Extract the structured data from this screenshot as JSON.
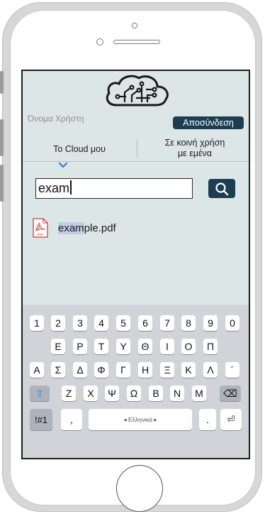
{
  "app": {
    "username_label": "Όνομα Χρήστη",
    "logout_label": "Αποσύνδεση"
  },
  "tabs": {
    "my_cloud": "Το Cloud μου",
    "shared_line1": "Σε κοινή χρήση",
    "shared_line2": "με εμένα"
  },
  "search": {
    "value": "exam",
    "button_icon": "magnifier-icon"
  },
  "results": [
    {
      "match": "exam",
      "rest": "ple.pdf",
      "icon": "pdf-file-icon",
      "icon_text": "PDF"
    }
  ],
  "keyboard": {
    "row1": [
      "1",
      "2",
      "3",
      "4",
      "5",
      "6",
      "7",
      "8",
      "9",
      "0"
    ],
    "row2": [
      "Ε",
      "Ρ",
      "Τ",
      "Υ",
      "Θ",
      "Ι",
      "Ο",
      "Π"
    ],
    "row3": [
      "Α",
      "Σ",
      "Δ",
      "Φ",
      "Γ",
      "Η",
      "Ξ",
      "Κ",
      "Λ",
      "´"
    ],
    "row4": [
      "Ζ",
      "Χ",
      "Ψ",
      "Ω",
      "Β",
      "Ν",
      "Μ"
    ],
    "shift_icon": "⇧",
    "backspace_icon": "⌫",
    "symbols_label": "!#1",
    "comma_label": ",",
    "space_label": "◂ Ελληνικά ▸",
    "period_label": ".",
    "return_icon": "⏎"
  },
  "colors": {
    "accent": "#1c3d52",
    "screen_bg": "#dde6e7",
    "highlight": "#bfcde6",
    "chevron": "#2f7fd6",
    "pdf_red": "#d03a3a"
  }
}
